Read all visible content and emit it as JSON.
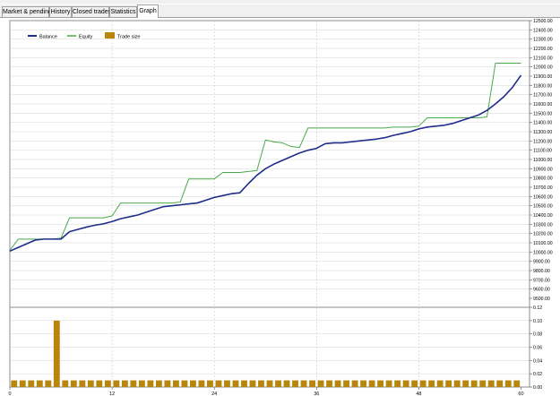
{
  "tabs": [
    {
      "label": "Market & pending"
    },
    {
      "label": "History"
    },
    {
      "label": "Closed trades"
    },
    {
      "label": "Statistics"
    },
    {
      "label": "Graph",
      "active": true
    }
  ],
  "colors": {
    "balance": "#1e2d8c",
    "equity": "#49a94b",
    "trade_size": "#b8860b",
    "grid": "#c8c8c8",
    "tab_bg": "#f0f0f0"
  },
  "chart_data": [
    {
      "type": "line",
      "grid": true,
      "legend": "top-left",
      "xlim": [
        0,
        61
      ],
      "ylim": [
        9500,
        12500
      ],
      "y_ticks": [
        "12500.00",
        "12400.00",
        "12300.00",
        "12200.00",
        "12100.00",
        "12000.00",
        "11900.00",
        "11800.00",
        "11700.00",
        "11600.00",
        "11500.00",
        "11400.00",
        "11300.00",
        "11200.00",
        "11100.00",
        "11000.00",
        "10900.00",
        "10800.00",
        "10700.00",
        "10600.00",
        "10500.00",
        "10400.00",
        "10300.00",
        "10200.00",
        "10100.00",
        "10000.00",
        "9900.00",
        "9800.00",
        "9700.00",
        "9600.00",
        "9500.00"
      ],
      "series": [
        {
          "name": "Balance",
          "x": [
            0,
            1,
            2,
            3,
            4,
            5,
            6,
            7,
            8,
            9,
            10,
            11,
            12,
            13,
            14,
            15,
            16,
            17,
            18,
            19,
            20,
            21,
            22,
            23,
            24,
            25,
            26,
            27,
            28,
            29,
            30,
            31,
            32,
            33,
            34,
            35,
            36,
            37,
            38,
            39,
            40,
            41,
            42,
            43,
            44,
            45,
            46,
            47,
            48,
            49,
            50,
            51,
            52,
            53,
            54,
            55,
            56,
            57,
            58,
            59,
            60
          ],
          "y": [
            10010,
            10050,
            10090,
            10130,
            10140,
            10140,
            10140,
            10220,
            10245,
            10270,
            10290,
            10305,
            10330,
            10360,
            10380,
            10400,
            10430,
            10460,
            10490,
            10500,
            10510,
            10520,
            10530,
            10560,
            10590,
            10610,
            10630,
            10640,
            10740,
            10830,
            10900,
            10950,
            10990,
            11030,
            11070,
            11100,
            11120,
            11170,
            11180,
            11180,
            11190,
            11200,
            11210,
            11220,
            11235,
            11260,
            11280,
            11300,
            11330,
            11350,
            11360,
            11370,
            11390,
            11420,
            11450,
            11480,
            11530,
            11600,
            11680,
            11780,
            11910
          ]
        },
        {
          "name": "Equity",
          "x": [
            0,
            1,
            2,
            3,
            4,
            5,
            6,
            7,
            8,
            9,
            10,
            11,
            12,
            13,
            14,
            15,
            16,
            17,
            18,
            19,
            20,
            21,
            22,
            23,
            24,
            25,
            26,
            27,
            28,
            29,
            30,
            31,
            32,
            33,
            34,
            35,
            36,
            37,
            38,
            39,
            40,
            41,
            42,
            43,
            44,
            45,
            46,
            47,
            48,
            49,
            50,
            51,
            52,
            53,
            54,
            55,
            56,
            57,
            58,
            59,
            60
          ],
          "y": [
            10020,
            10140,
            10140,
            10140,
            10140,
            10140,
            10150,
            10370,
            10370,
            10370,
            10370,
            10370,
            10390,
            10530,
            10530,
            10530,
            10530,
            10530,
            10530,
            10530,
            10540,
            10790,
            10790,
            10790,
            10790,
            10860,
            10860,
            10860,
            10870,
            10880,
            11210,
            11190,
            11180,
            11140,
            11130,
            11340,
            11340,
            11340,
            11340,
            11340,
            11340,
            11340,
            11340,
            11340,
            11340,
            11350,
            11350,
            11350,
            11360,
            11450,
            11450,
            11450,
            11450,
            11450,
            11450,
            11450,
            11460,
            12040,
            12040,
            12040,
            12040
          ]
        }
      ]
    },
    {
      "type": "bar",
      "grid": true,
      "xlim": [
        0,
        61
      ],
      "ylim": [
        0,
        0.12
      ],
      "y_ticks": [
        "0.12",
        "0.10",
        "0.08",
        "0.06",
        "0.04",
        "0.02",
        "0.00"
      ],
      "x_ticks": [
        "0",
        "12",
        "24",
        "36",
        "48",
        "60"
      ],
      "series": [
        {
          "name": "Trade size",
          "x": [
            1,
            2,
            3,
            4,
            5,
            6,
            7,
            8,
            9,
            10,
            11,
            12,
            13,
            14,
            15,
            16,
            17,
            18,
            19,
            20,
            21,
            22,
            23,
            24,
            25,
            26,
            27,
            28,
            29,
            30,
            31,
            32,
            33,
            34,
            35,
            36,
            37,
            38,
            39,
            40,
            41,
            42,
            43,
            44,
            45,
            46,
            47,
            48,
            49,
            50,
            51,
            52,
            53,
            54,
            55,
            56,
            57,
            58,
            59,
            60
          ],
          "values": [
            0.01,
            0.01,
            0.01,
            0.01,
            0.01,
            0.1,
            0.01,
            0.01,
            0.01,
            0.01,
            0.01,
            0.01,
            0.01,
            0.01,
            0.01,
            0.01,
            0.01,
            0.01,
            0.01,
            0.01,
            0.01,
            0.01,
            0.01,
            0.01,
            0.01,
            0.01,
            0.01,
            0.01,
            0.01,
            0.01,
            0.01,
            0.01,
            0.01,
            0.01,
            0.01,
            0.01,
            0.01,
            0.01,
            0.01,
            0.01,
            0.01,
            0.01,
            0.01,
            0.01,
            0.01,
            0.01,
            0.01,
            0.01,
            0.01,
            0.01,
            0.01,
            0.01,
            0.01,
            0.01,
            0.01,
            0.01,
            0.01,
            0.01,
            0.01,
            0.01
          ]
        }
      ]
    }
  ]
}
